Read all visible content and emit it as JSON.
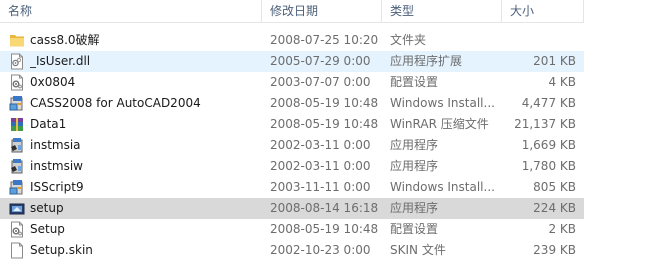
{
  "columns": {
    "name": "名称",
    "date": "修改日期",
    "type": "类型",
    "size": "大小"
  },
  "files": [
    {
      "name": "cass8.0破解",
      "date": "2008-07-25 10:20",
      "type": "文件夹",
      "size": "",
      "icon": "folder-icon"
    },
    {
      "name": "_IsUser.dll",
      "date": "2005-07-29 0:00",
      "type": "应用程序扩展",
      "size": "201 KB",
      "icon": "dll-file-icon"
    },
    {
      "name": "0x0804",
      "date": "2003-07-07 0:00",
      "type": "配置设置",
      "size": "4 KB",
      "icon": "settings-file-icon"
    },
    {
      "name": "CASS2008 for AutoCAD2004",
      "date": "2008-05-19 10:48",
      "type": "Windows Install...",
      "size": "4,477 KB",
      "icon": "installer-package-icon"
    },
    {
      "name": "Data1",
      "date": "2008-05-19 10:48",
      "type": "WinRAR 压缩文件",
      "size": "21,137 KB",
      "icon": "winrar-archive-icon"
    },
    {
      "name": "instmsia",
      "date": "2002-03-11 0:00",
      "type": "应用程序",
      "size": "1,669 KB",
      "icon": "installer-exe-icon"
    },
    {
      "name": "instmsiw",
      "date": "2002-03-11 0:00",
      "type": "应用程序",
      "size": "1,780 KB",
      "icon": "installer-exe-icon"
    },
    {
      "name": "ISScript9",
      "date": "2003-11-11 0:00",
      "type": "Windows Install...",
      "size": "805 KB",
      "icon": "installer-package-icon"
    },
    {
      "name": "setup",
      "date": "2008-08-14 16:18",
      "type": "应用程序",
      "size": "224 KB",
      "icon": "setup-exe-icon"
    },
    {
      "name": "Setup",
      "date": "2008-05-19 10:48",
      "type": "配置设置",
      "size": "2 KB",
      "icon": "settings-file-icon"
    },
    {
      "name": "Setup.skin",
      "date": "2002-10-23 0:00",
      "type": "SKIN 文件",
      "size": "239 KB",
      "icon": "generic-file-icon"
    }
  ],
  "hover_row": "_IsUser.dll",
  "selected_row": "setup"
}
